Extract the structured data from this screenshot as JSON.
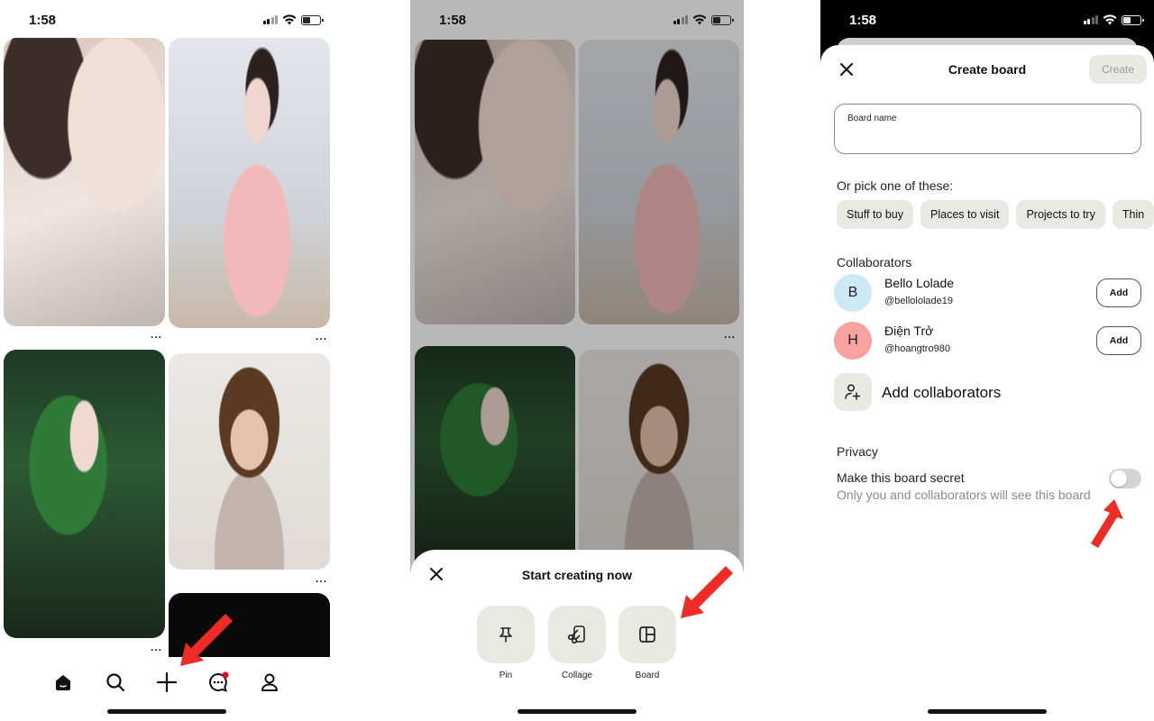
{
  "screens": [
    {
      "status": {
        "time": "1:58"
      },
      "tabs": [
        {
          "name": "home-icon"
        },
        {
          "name": "search-icon"
        },
        {
          "name": "plus-icon"
        },
        {
          "name": "chat-icon",
          "badge": true
        },
        {
          "name": "profile-icon"
        }
      ],
      "more_label": "..."
    },
    {
      "status": {
        "time": "1:58"
      },
      "sheet": {
        "title": "Start creating now",
        "options": [
          {
            "label": "Pin",
            "icon": "pushpin-icon"
          },
          {
            "label": "Collage",
            "icon": "scissors-icon"
          },
          {
            "label": "Board",
            "icon": "board-icon"
          }
        ]
      }
    },
    {
      "status": {
        "time": "1:58"
      },
      "header": {
        "title": "Create board",
        "create_label": "Create"
      },
      "board_name": {
        "label": "Board name",
        "value": ""
      },
      "suggestions": {
        "heading": "Or pick one of these:",
        "chips": [
          "Stuff to buy",
          "Places to visit",
          "Projects to try",
          "Thin"
        ]
      },
      "collaborators": {
        "heading": "Collaborators",
        "people": [
          {
            "initial": "B",
            "name": "Bello Lolade",
            "handle": "@bellololade19",
            "avatar_color": "#cde9f8",
            "add_label": "Add"
          },
          {
            "initial": "H",
            "name": "Điện Trở",
            "handle": "@hoangtro980",
            "avatar_color": "#f7a2a0",
            "add_label": "Add"
          }
        ],
        "add_label": "Add collaborators"
      },
      "privacy": {
        "heading": "Privacy",
        "secret_label": "Make this board secret",
        "secret_desc": "Only you and collaborators will see this board",
        "secret_on": false
      }
    }
  ],
  "colors": {
    "arrow": "#ee2b24",
    "chip_bg": "#e9e9e4",
    "notification": "#e60023"
  }
}
